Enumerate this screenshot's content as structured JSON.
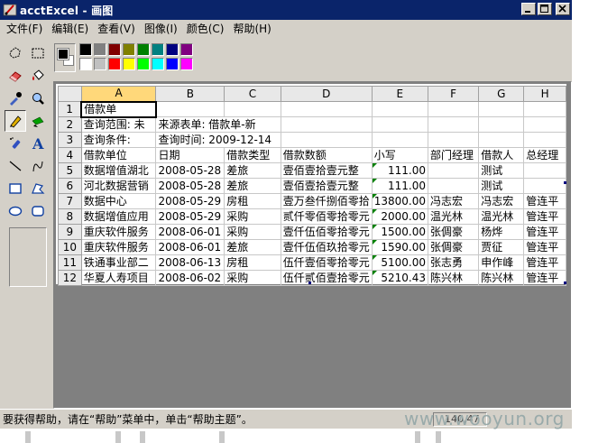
{
  "window": {
    "title": "acctExcel - 画图"
  },
  "menubar": {
    "items": [
      "文件(F)",
      "编辑(E)",
      "查看(V)",
      "图像(I)",
      "颜色(C)",
      "帮助(H)"
    ]
  },
  "palette": {
    "foreground": "#000000",
    "background": "#ffffff",
    "colors_row1": [
      "#000000",
      "#808080",
      "#800000",
      "#808000",
      "#008000",
      "#008080",
      "#000080",
      "#800080"
    ],
    "colors_row2": [
      "#ffffff",
      "#c0c0c0",
      "#ff0000",
      "#ffff00",
      "#00ff00",
      "#00ffff",
      "#0000ff",
      "#ff00ff"
    ]
  },
  "tools": [
    "free-select-icon",
    "rect-select-icon",
    "eraser-icon",
    "fill-icon",
    "color-picker-icon",
    "magnifier-icon",
    "pencil-icon",
    "brush-icon",
    "airbrush-icon",
    "text-icon",
    "line-icon",
    "curve-icon",
    "rectangle-icon",
    "polygon-icon",
    "ellipse-icon",
    "rounded-rect-icon"
  ],
  "sheet": {
    "columns": [
      "A",
      "B",
      "C",
      "D",
      "E",
      "F",
      "G",
      "H"
    ],
    "rows": [
      {
        "n": "1",
        "cells": [
          "借款单",
          "",
          "",
          "",
          "",
          "",
          "",
          ""
        ]
      },
      {
        "n": "2",
        "cells": [
          "查询范围:  未",
          "来源表单:  借款单-新",
          "",
          "",
          "",
          "",
          "",
          ""
        ]
      },
      {
        "n": "3",
        "cells": [
          "查询条件:",
          "查询时间:  2009-12-14",
          "",
          "",
          "",
          "",
          "",
          ""
        ]
      },
      {
        "n": "4",
        "cells": [
          "借款单位",
          "日期",
          "借款类型",
          "借款数额",
          "小写",
          "部门经理",
          "借款人",
          "总经理"
        ]
      },
      {
        "n": "5",
        "cells": [
          "数据增值湖北",
          "2008-05-28",
          "差旅",
          "壹佰壹拾壹元整",
          "111.00",
          "",
          "测试",
          ""
        ]
      },
      {
        "n": "6",
        "cells": [
          "河北数据营销",
          "2008-05-28",
          "差旅",
          "壹佰壹拾壹元整",
          "111.00",
          "",
          "测试",
          ""
        ]
      },
      {
        "n": "7",
        "cells": [
          "数据中心",
          "2008-05-29",
          "房租",
          "壹万叁仟捌佰零拾",
          "13800.00",
          "冯志宏",
          "冯志宏",
          "管连平"
        ]
      },
      {
        "n": "8",
        "cells": [
          "数据增值应用",
          "2008-05-29",
          "采购",
          "贰仟零佰零拾零元",
          "2000.00",
          "温光林",
          "温光林",
          "管连平"
        ]
      },
      {
        "n": "9",
        "cells": [
          "重庆软件服务",
          "2008-06-01",
          "采购",
          "壹仟伍佰零拾零元",
          "1500.00",
          "张倜豪",
          "杨烨",
          "管连平"
        ]
      },
      {
        "n": "10",
        "cells": [
          "重庆软件服务",
          "2008-06-01",
          "差旅",
          "壹仟伍佰玖拾零元",
          "1590.00",
          "张倜豪",
          "贾征",
          "管连平"
        ]
      },
      {
        "n": "11",
        "cells": [
          "铁通事业部二",
          "2008-06-13",
          "房租",
          "伍仟壹佰零拾零元",
          "5100.00",
          "张志勇",
          "申作峰",
          "管连平"
        ]
      },
      {
        "n": "12",
        "cells": [
          "华夏人寿项目",
          "2008-06-02",
          "采购",
          "伍仟贰佰壹拾零元",
          "5210.43",
          "陈兴林",
          "陈兴林",
          "管连平"
        ]
      }
    ]
  },
  "status": {
    "message": "要获得帮助，请在“帮助”菜单中，单击“帮助主题”。",
    "coords": "140,47"
  },
  "watermark": "www.wooyun.org"
}
